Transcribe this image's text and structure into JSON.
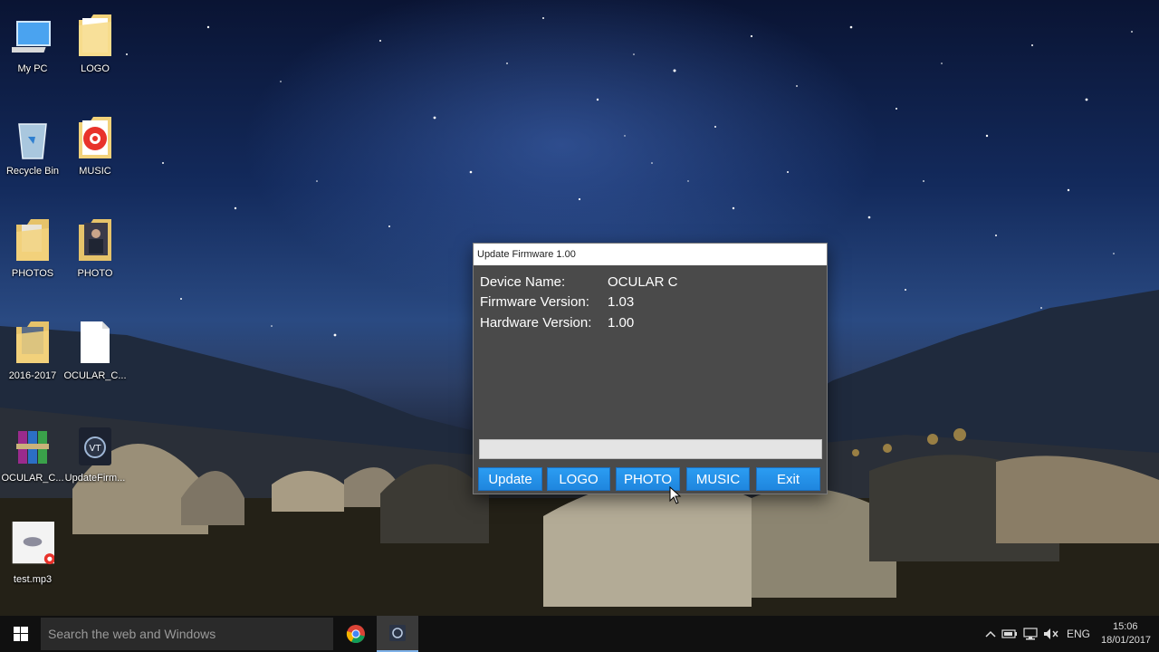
{
  "desktop": {
    "icons": [
      {
        "label": "My PC",
        "icon": "computer-icon"
      },
      {
        "label": "LOGO",
        "icon": "folder-icon"
      },
      {
        "label": "Recycle Bin",
        "icon": "recycle-bin-icon"
      },
      {
        "label": "MUSIC",
        "icon": "music-folder-icon"
      },
      {
        "label": "PHOTOS",
        "icon": "folder-icon"
      },
      {
        "label": "PHOTO",
        "icon": "photo-folder-icon"
      },
      {
        "label": "2016-2017",
        "icon": "folder-icon"
      },
      {
        "label": "OCULAR_C...",
        "icon": "file-icon"
      },
      {
        "label": "OCULAR_C...",
        "icon": "archive-icon"
      },
      {
        "label": "UpdateFirm...",
        "icon": "app-icon"
      },
      {
        "label": "test.mp3",
        "icon": "mp3-file-icon"
      }
    ]
  },
  "dialog": {
    "title": "Update Firmware 1.00",
    "device_name_label": "Device Name:",
    "device_name_value": "OCULAR C",
    "firmware_label": "Firmware Version:",
    "firmware_value": "1.03",
    "hardware_label": "Hardware Version:",
    "hardware_value": "1.00",
    "progress": 0,
    "buttons": {
      "update": "Update",
      "logo": "LOGO",
      "photo": "PHOTO",
      "music": "MUSIC",
      "exit": "Exit"
    }
  },
  "taskbar": {
    "search_placeholder": "Search the web and Windows",
    "language": "ENG",
    "time": "15:06",
    "date": "18/01/2017"
  },
  "colors": {
    "button_blue": "#1f86de",
    "dialog_bg": "#4a4a4a",
    "taskbar_bg": "#101010"
  }
}
